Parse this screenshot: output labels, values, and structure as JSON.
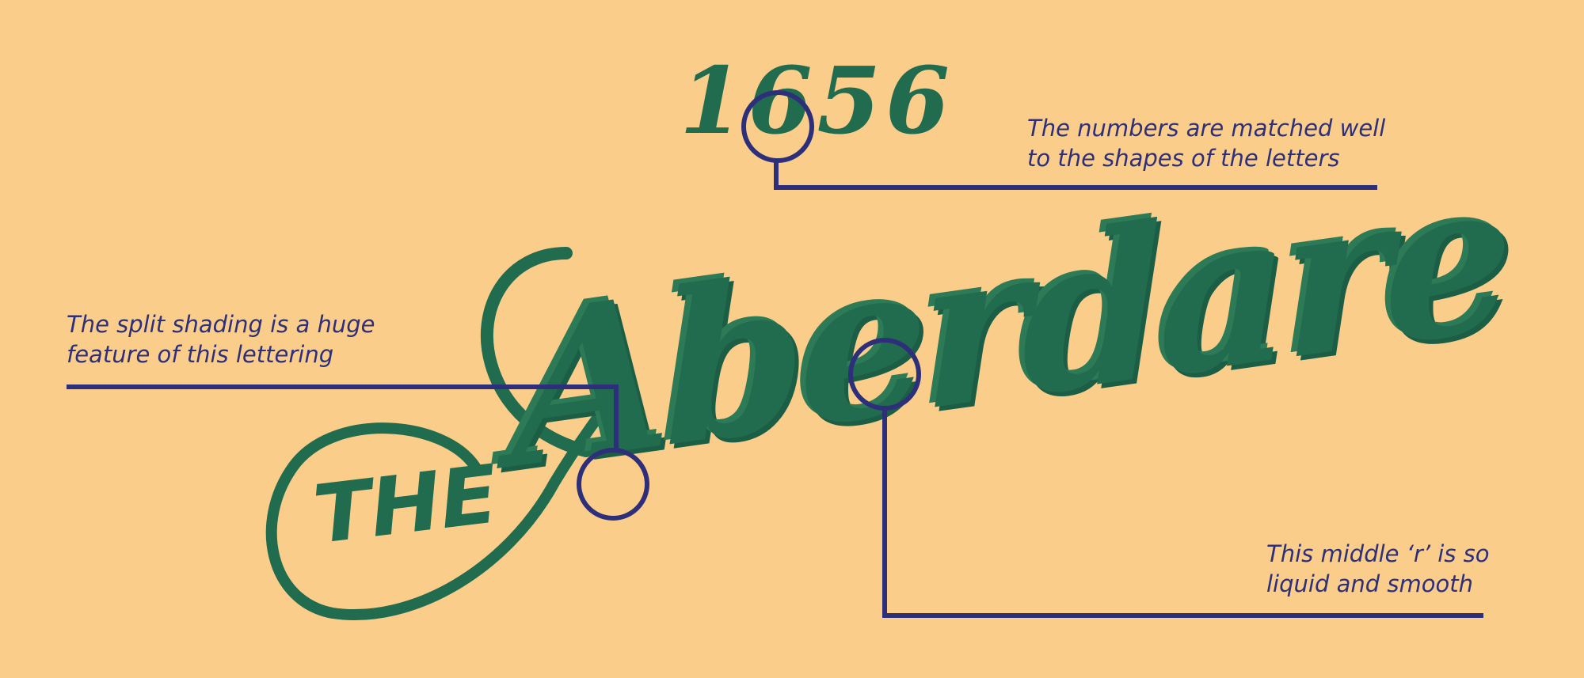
{
  "lettering": {
    "year": "1656",
    "prefix": "THE",
    "title": "Aberdare"
  },
  "annotations": [
    {
      "lines": [
        "The numbers are matched well",
        "to the shapes of the letters"
      ]
    },
    {
      "lines": [
        "The split shading is a huge",
        "feature of this lettering"
      ]
    },
    {
      "lines": [
        "This middle ‘r’ is so",
        "liquid and smooth"
      ]
    }
  ],
  "colors": {
    "background": "#FACE8A",
    "lettering_green": "#216B4E",
    "callout_navy": "#2E2F7A"
  }
}
